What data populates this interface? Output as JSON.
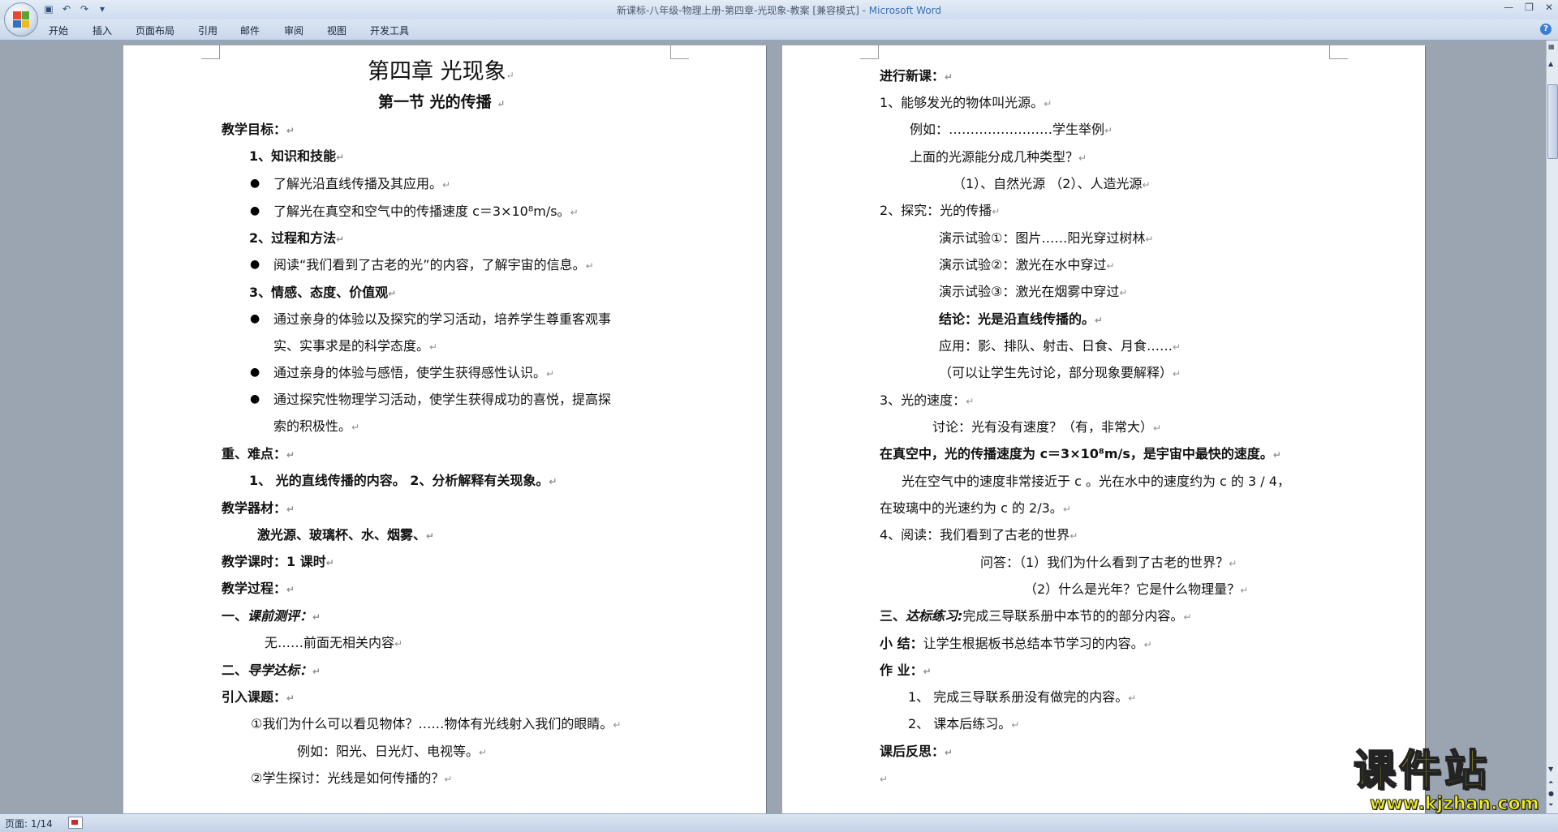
{
  "window": {
    "doc_title": "新课标-八年级-物理上册-第四章-光现象-教案 [兼容模式] - ",
    "app_name": "Microsoft Word",
    "minimize": "—",
    "restore": "❐",
    "close": "✕"
  },
  "ribbon": {
    "tabs": [
      "开始",
      "插入",
      "页面布局",
      "引用",
      "邮件",
      "审阅",
      "视图",
      "开发工具"
    ],
    "help": "?"
  },
  "status": {
    "page": "页面: 1/14"
  },
  "left_page": {
    "chapter": "第四章  光现象",
    "section": "第一节    光的传播",
    "goals_label": "教学目标：",
    "knowledge": "1、知识和技能",
    "k1": "了解光沿直线传播及其应用。",
    "k2": "了解光在真空和空气中的传播速度 c＝3×10⁸m/s。",
    "process": "2、过程和方法",
    "p1": "阅读“我们看到了古老的光”的内容，了解宇宙的信息。",
    "emotion": "3、情感、态度、价值观",
    "e1a": "通过亲身的体验以及探究的学习活动，培养学生尊重客观事",
    "e1b": "实、实事求是的科学态度。",
    "e2": "通过亲身的体验与感悟，使学生获得感性认识。",
    "e3a": "通过探究性物理学习活动，使学生获得成功的喜悦，提高探",
    "e3b": "索的积极性。",
    "key_label": "重、难点：",
    "key_content": "1、    光的直线传播的内容。     2、分析解释有关现象。",
    "equip_label": "教学器材：",
    "equip_content": "激光源、玻璃杯、水、烟雾、",
    "hours": "教学课时：1 课时",
    "procedure": "教学过程：",
    "pre_prefix": "一、",
    "pre_test": "课前测评：",
    "pre_content": "无……前面无相关内容",
    "guide_prefix": "二、",
    "guide": "导学达标：",
    "intro_label": "引入课题：",
    "q1": "①我们为什么可以看见物体？……物体有光线射入我们的眼睛。",
    "q1_ex": "例如：阳光、日光灯、电视等。",
    "q2": "②学生探讨：光线是如何传播的？"
  },
  "right_page": {
    "new_lesson": "进行新课：",
    "r1": "1、能够发光的物体叫光源。",
    "r1_ex": "例如：……………………学生举例",
    "r1_q": "上面的光源能分成几种类型？",
    "r1_types": "（1）、自然光源              （2）、人造光源",
    "r2": "2、探究：光的传播",
    "demo1": "演示试验①：图片……阳光穿过树林",
    "demo2": "演示试验②：激光在水中穿过",
    "demo3": "演示试验③：激光在烟雾中穿过",
    "conclusion": "结论：光是沿直线传播的。",
    "apply": "应用：影、排队、射击、日食、月食……",
    "discuss_note": "（可以让学生先讨论，部分现象要解释）",
    "r3": "3、光的速度：",
    "r3_discuss": "讨论：光有没有速度？（有，非常大）",
    "speed_bold": "在真空中，光的传播速度为 c＝3×10⁸m/s，是宇宙中最快的速度。",
    "speed_line1": "光在空气中的速度非常接近于 c 。光在水中的速度约为 c 的 3 / 4，",
    "speed_line2": "在玻璃中的光速约为 c 的 2/3。",
    "r4": "4、阅读：我们看到了古老的世界",
    "ask1": "问答：（1）我们为什么看到了古老的世界？",
    "ask2": "（2）什么是光年？它是什么物理量？",
    "practice_prefix": "三、",
    "practice_label": "达标练习:",
    "practice_content": "完成三导联系册中本节的的部分内容。",
    "summary_label": "小      结：",
    "summary_content": "让学生根据板书总结本节学习的内容。",
    "homework": "作      业：",
    "hw1": "1、    完成三导联系册没有做完的内容。",
    "hw2": "2、    课本后练习。",
    "reflection": "课后反思："
  },
  "watermark": {
    "text": "课件站",
    "url": "www.kjzhan.com"
  },
  "colors": {
    "page": "#ffffff",
    "workspace": "#9ba5b2",
    "ribbon": "#d5e1f2",
    "watermark": "#f4f016"
  }
}
